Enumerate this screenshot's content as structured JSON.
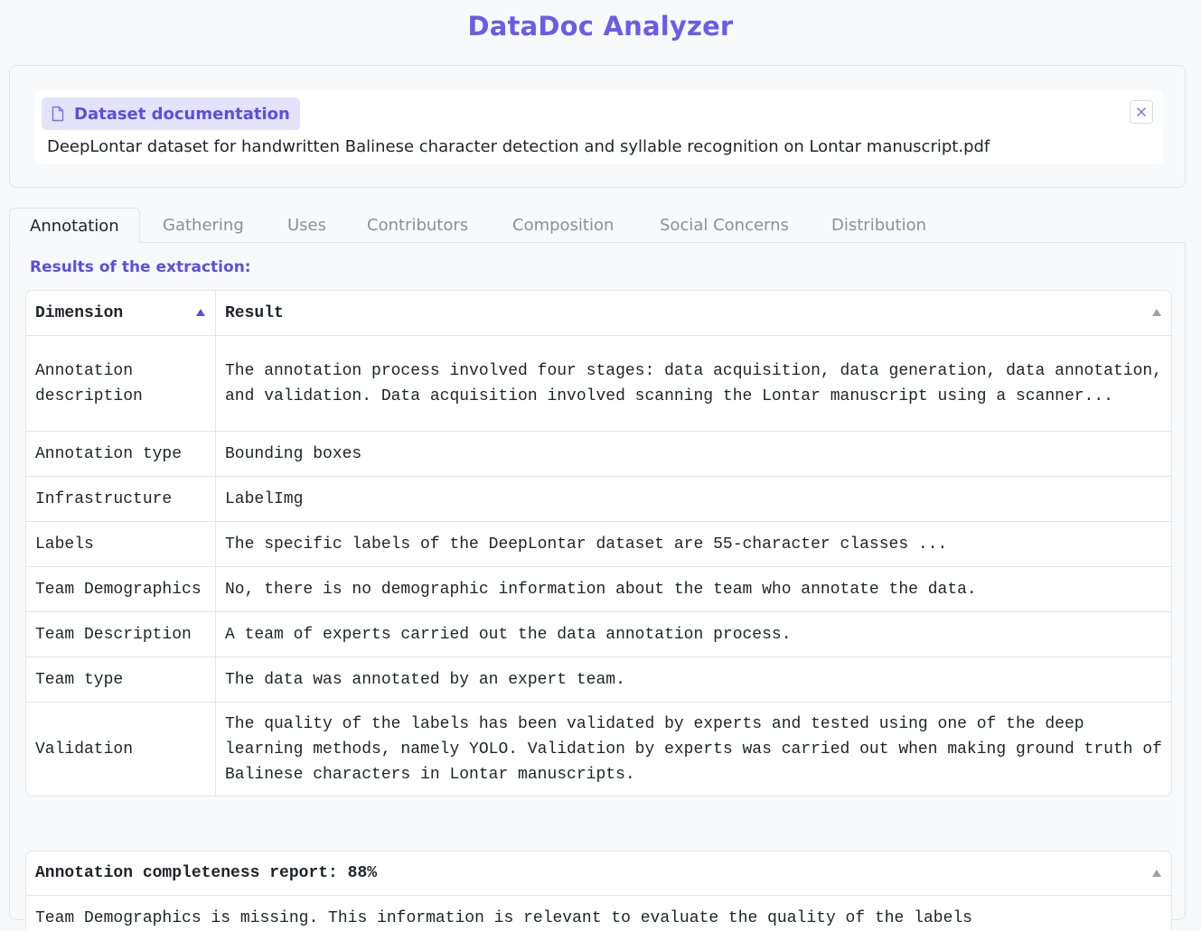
{
  "app": {
    "title": "DataDoc Analyzer"
  },
  "upload": {
    "badge_label": "Dataset documentation",
    "file_name": "DeepLontar dataset for handwritten Balinese character detection and syllable recognition on Lontar manuscript.pdf",
    "close_label": "×"
  },
  "tabs": [
    {
      "label": "Annotation",
      "active": true
    },
    {
      "label": "Gathering",
      "active": false
    },
    {
      "label": "Uses",
      "active": false
    },
    {
      "label": "Contributors",
      "active": false
    },
    {
      "label": "Composition",
      "active": false
    },
    {
      "label": "Social Concerns",
      "active": false
    },
    {
      "label": "Distribution",
      "active": false
    }
  ],
  "results": {
    "label": "Results of the extraction:",
    "columns": [
      "Dimension",
      "Result"
    ],
    "rows": [
      {
        "dimension": "Annotation description",
        "result": "The annotation process involved four stages: data acquisition, data generation, data annotation, and validation. Data acquisition involved scanning the Lontar manuscript using a scanner..."
      },
      {
        "dimension": "Annotation type",
        "result": "Bounding boxes"
      },
      {
        "dimension": "Infrastructure",
        "result": "LabelImg"
      },
      {
        "dimension": "Labels",
        "result": "The specific labels of the DeepLontar dataset are 55-character classes ..."
      },
      {
        "dimension": "Team Demographics",
        "result": "No, there is no demographic information about the team who annotate the data."
      },
      {
        "dimension": "Team Description",
        "result": "A team of experts carried out the data annotation process."
      },
      {
        "dimension": "Team type",
        "result": "The data was annotated by an expert team."
      },
      {
        "dimension": "Validation",
        "result": "The quality of the labels has been validated by experts and tested using one of the deep learning methods, namely YOLO. Validation by experts was carried out when making ground truth of Balinese characters in Lontar manuscripts."
      }
    ]
  },
  "report": {
    "title": "Annotation completeness report: 88%",
    "body": "Team Demographics is missing. This information is relevant to evaluate the quality of the labels"
  },
  "colors": {
    "accent": "#5b4fe0",
    "title": "#6a5ce8",
    "badge_bg": "#e4e3fb",
    "border": "#e3e5ea"
  }
}
